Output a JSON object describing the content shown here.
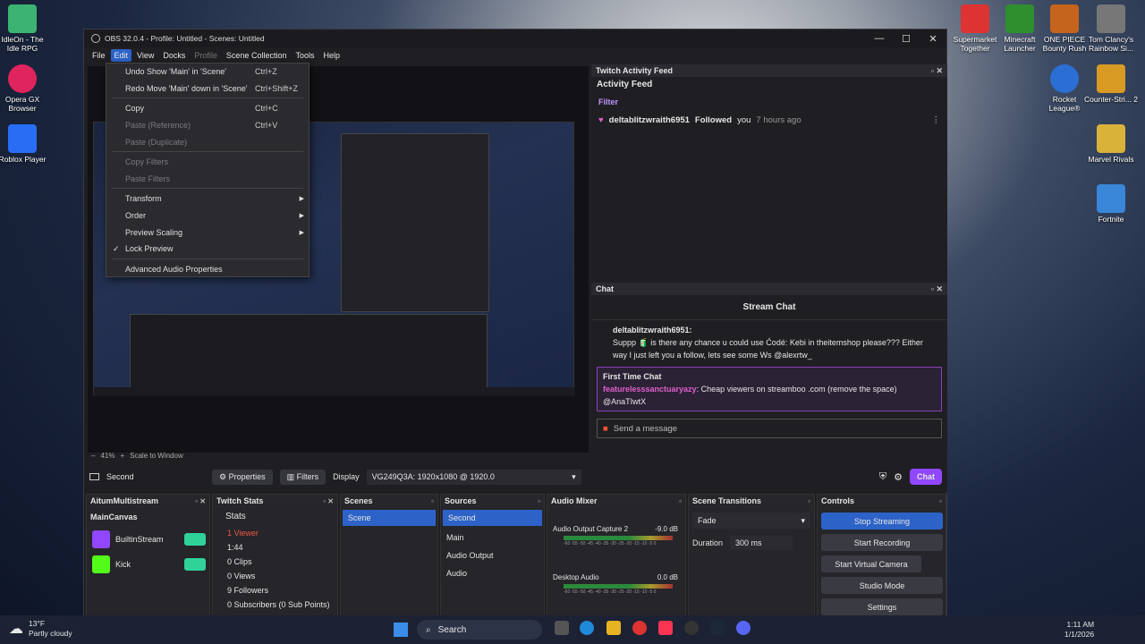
{
  "desktop": {
    "icons_left": [
      {
        "label": "IdleOn - The Idle RPG",
        "color": "#3cb371"
      },
      {
        "label": "Opera GX Browser",
        "color": "#e0245e"
      },
      {
        "label": "Roblox Player",
        "color": "#2a6df5"
      }
    ],
    "icons_right": [
      {
        "label": "Supermarket Together",
        "color": "#d33"
      },
      {
        "label": "Minecraft Launcher",
        "color": "#2f8f2f"
      },
      {
        "label": "ONE PIECE Bounty Rush",
        "color": "#c5641c"
      },
      {
        "label": "Tom Clancy's Rainbow Si...",
        "color": "#777"
      },
      {
        "label": "Rocket League®",
        "color": "#2b6fd4"
      },
      {
        "label": "Counter-Stri... 2",
        "color": "#d89a22"
      },
      {
        "label": "Marvel Rivals",
        "color": "#d9b23a"
      },
      {
        "label": "Fortnite",
        "color": "#3a86d8"
      }
    ]
  },
  "window": {
    "title": "OBS 32.0.4 - Profile: Untitled - Scenes: Untitled",
    "minimize": "—",
    "maximize": "☐",
    "close": "✕"
  },
  "menubar": {
    "items": [
      "File",
      "Edit",
      "View",
      "Docks",
      "Profile",
      "Scene Collection",
      "Tools",
      "Help"
    ]
  },
  "edit_menu": {
    "undo": "Undo Show 'Main' in 'Scene'",
    "undo_sc": "Ctrl+Z",
    "redo": "Redo Move 'Main' down in 'Scene'",
    "redo_sc": "Ctrl+Shift+Z",
    "copy": "Copy",
    "copy_sc": "Ctrl+C",
    "paste_ref": "Paste (Reference)",
    "paste_ref_sc": "Ctrl+V",
    "paste_dup": "Paste (Duplicate)",
    "copy_filters": "Copy Filters",
    "paste_filters": "Paste Filters",
    "transform": "Transform",
    "order": "Order",
    "preview_scaling": "Preview Scaling",
    "lock_preview": "Lock Preview",
    "advanced_audio": "Advanced Audio Properties"
  },
  "preview_bar": {
    "zoom": "41%",
    "scale": "Scale to Window",
    "minus": "–",
    "plus": "+"
  },
  "source_bar": {
    "source": "Second",
    "properties": "Properties",
    "filters": "Filters",
    "display_label": "Display",
    "display_value": "VG249Q3A: 1920x1080 @ 1920.0"
  },
  "activity": {
    "dock_title": "Twitch Activity Feed",
    "title": "Activity Feed",
    "filter": "Filter",
    "user": "deltablitzwraith6951",
    "action": "Followed",
    "you": "you",
    "time": "7 hours ago"
  },
  "chat": {
    "dock_title": "Chat",
    "title": "Stream Chat",
    "msg_user": "deltablitzwraith6951:",
    "msg_text": "Suppp 🧃 is there any chance u could use Ćodé: Kebi in theitemshop please??? Either way I just left you a follow, lets see some Ws @alexrtw_",
    "ftc_label": "First Time Chat",
    "ftc_user": "featurelesssanctuaryazy",
    "ftc_text": "Cheap viewers on streamboo .com (remove the space) @AnaTIwtX",
    "input_placeholder": "Send a message",
    "chat_button": "Chat"
  },
  "multistream": {
    "title": "AitumMultistream",
    "canvas": "MainCanvas",
    "platforms": [
      "BuiltinStream",
      "Kick"
    ]
  },
  "stats": {
    "title": "Twitch Stats",
    "heading": "Stats",
    "items": [
      "1 Viewer",
      "1:44",
      "0 Clips",
      "0 Views",
      "9 Followers",
      "0 Subscribers (0 Sub Points)"
    ]
  },
  "scenes": {
    "title": "Scenes",
    "items": [
      "Scene"
    ]
  },
  "sources": {
    "title": "Sources",
    "items": [
      "Second",
      "Main",
      "Audio Output",
      "Audio"
    ]
  },
  "mixer": {
    "title": "Audio Mixer",
    "ch1_name": "Audio Output Capture 2",
    "ch1_db": "-9.0 dB",
    "ch2_name": "Desktop Audio",
    "ch2_db": "0.0 dB",
    "scale": "-60 -55 -50 -45 -40 -35 -30 -25 -20 -15 -10 -5 0"
  },
  "transitions": {
    "title": "Scene Transitions",
    "type": "Fade",
    "duration_label": "Duration",
    "duration": "300 ms"
  },
  "controls": {
    "title": "Controls",
    "stop_streaming": "Stop Streaming",
    "start_recording": "Start Recording",
    "start_virtual": "Start Virtual Camera",
    "studio_mode": "Studio Mode",
    "settings": "Settings"
  },
  "taskbar": {
    "temp": "13°F",
    "weather": "Partly cloudy",
    "search": "Search",
    "time": "1:11 AM",
    "date": "1/1/2026"
  },
  "colors": {
    "accent": "#2d63c8",
    "twitch": "#9147ff",
    "kick": "#53fc18",
    "stream_green": "#2fd39a"
  }
}
